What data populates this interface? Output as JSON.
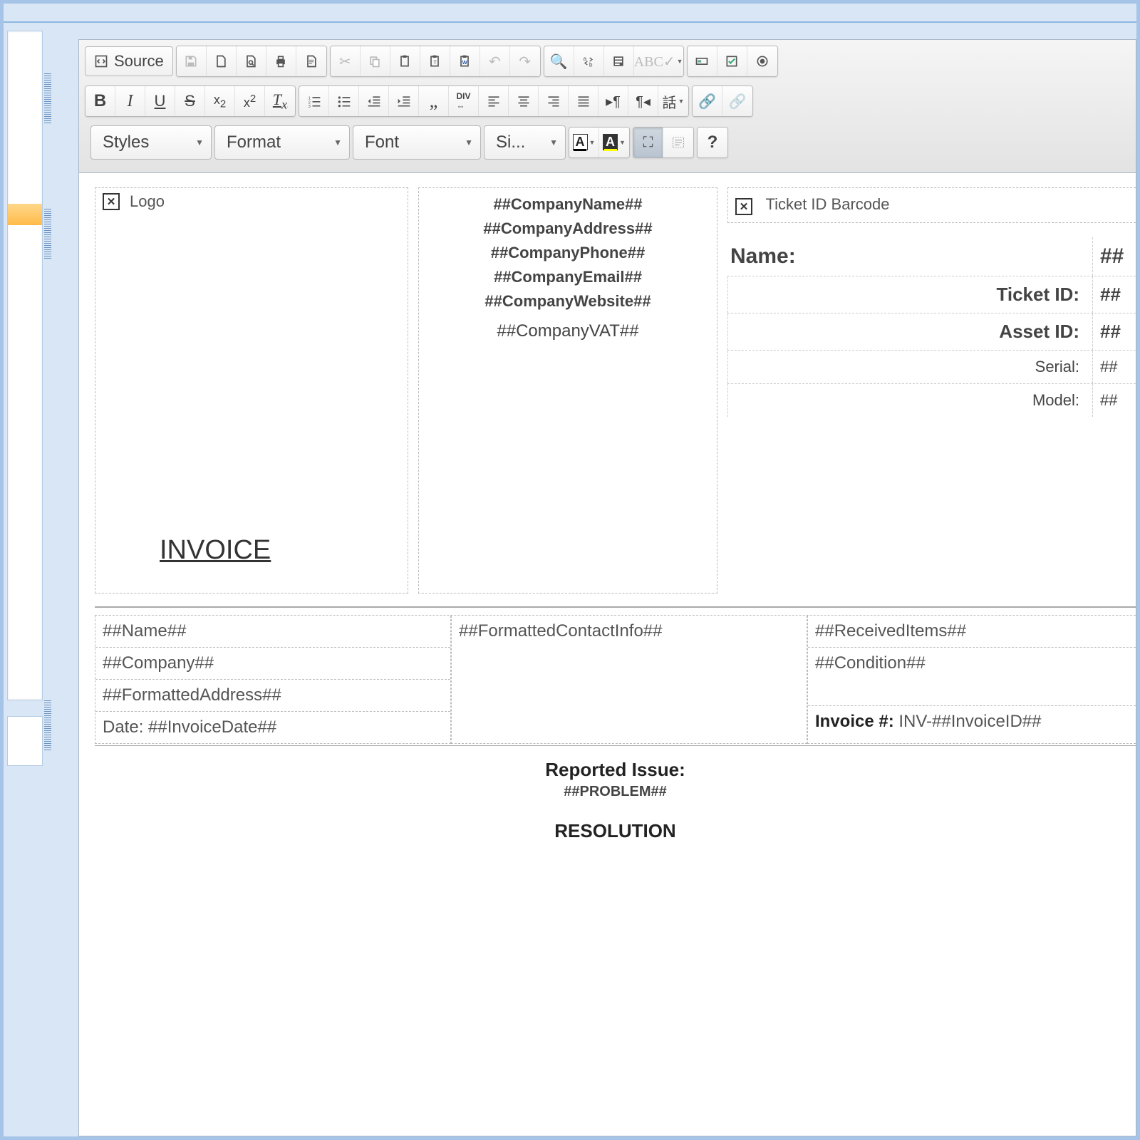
{
  "toolbar": {
    "source_label": "Source",
    "styles": "Styles",
    "format": "Format",
    "font": "Font",
    "size": "Si..."
  },
  "doc": {
    "logo_label": "Logo",
    "barcode_label": "Ticket ID Barcode",
    "company": {
      "name": "##CompanyName##",
      "address": "##CompanyAddress##",
      "phone": "##CompanyPhone##",
      "email": "##CompanyEmail##",
      "website": "##CompanyWebsite##",
      "vat": "##CompanyVAT##"
    },
    "invoice_title": "INVOICE",
    "ticket": {
      "name_label": "Name:",
      "ticket_id_label": "Ticket ID:",
      "asset_id_label": "Asset ID:",
      "serial_label": "Serial:",
      "model_label": "Model:",
      "value_frag": "##"
    },
    "info": {
      "name": "##Name##",
      "company": "##Company##",
      "formatted_address": "##FormattedAddress##",
      "date_prefix": "Date: ",
      "date_val": "##InvoiceDate##",
      "contact": "##FormattedContactInfo##",
      "received": "##ReceivedItems##",
      "condition": "##Condition##",
      "invoice_num_prefix": "Invoice #: ",
      "invoice_num_val": "INV-##InvoiceID##"
    },
    "reported": {
      "title": "Reported Issue:",
      "value": "##PROBLEM##",
      "resolution_title": "RESOLUTION"
    }
  }
}
